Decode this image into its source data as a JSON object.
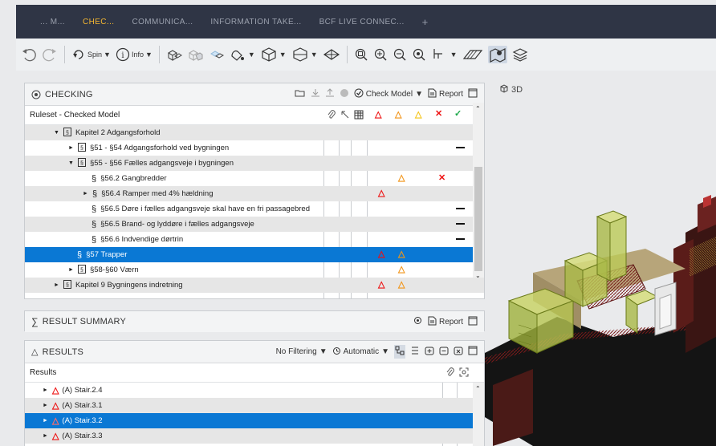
{
  "tabs": [
    {
      "label": "... M...",
      "active": false
    },
    {
      "label": "CHEC...",
      "active": true
    },
    {
      "label": "COMMUNICA...",
      "active": false
    },
    {
      "label": "INFORMATION TAKE...",
      "active": false
    },
    {
      "label": "BCF LIVE CONNEC...",
      "active": false
    },
    {
      "label": "+",
      "active": false
    }
  ],
  "toolbar": {
    "spin_label": "Spin",
    "info_label": "Info"
  },
  "checking": {
    "title": "CHECKING",
    "check_model_label": "Check Model",
    "report_label": "Report",
    "column_header": "Ruleset - Checked Model",
    "rows": [
      {
        "label": "Kapitel 2 Adgangsforhold",
        "indent": 1,
        "arrow": "▼",
        "icon": "book",
        "marks": []
      },
      {
        "label": "§51 - §54 Adgangsforhold ved bygningen",
        "indent": 2,
        "arrow": "►",
        "icon": "book",
        "marks": [
          "dash"
        ]
      },
      {
        "label": "§55 - §56  Fælles adgangsveje i bygningen",
        "indent": 2,
        "arrow": "▼",
        "icon": "book",
        "marks": []
      },
      {
        "label": "§56.2 Gangbredder",
        "indent": 3,
        "arrow": "",
        "icon": "para",
        "marks": [
          "orange",
          "x"
        ]
      },
      {
        "label": "§56.4 Ramper med 4% hældning",
        "indent": 3,
        "arrow": "►",
        "icon": "para",
        "marks": [
          "red"
        ]
      },
      {
        "label": "§56.5 Døre i fælles adgangsveje skal have en fri passagebred",
        "indent": 3,
        "arrow": "",
        "icon": "para",
        "marks": [
          "dash"
        ]
      },
      {
        "label": "§56.5 Brand- og lyddøre i fælles adgangsveje",
        "indent": 3,
        "arrow": "",
        "icon": "para",
        "marks": [
          "dash"
        ]
      },
      {
        "label": "§56.6 Indvendige dørtrin",
        "indent": 3,
        "arrow": "",
        "icon": "para",
        "marks": [
          "dash"
        ]
      },
      {
        "label": "§57 Trapper",
        "indent": 2,
        "arrow": "",
        "icon": "para",
        "marks": [
          "red",
          "orange"
        ],
        "selected": true
      },
      {
        "label": "§58-§60 Værn",
        "indent": 2,
        "arrow": "►",
        "icon": "book",
        "marks": [
          "orange"
        ]
      },
      {
        "label": "Kapitel 9 Bygningens indretning",
        "indent": 1,
        "arrow": "►",
        "icon": "book",
        "marks": [
          "red",
          "orange"
        ]
      }
    ]
  },
  "result_summary": {
    "title": "RESULT SUMMARY",
    "report_label": "Report"
  },
  "results": {
    "title": "RESULTS",
    "filter_label": "No Filtering",
    "auto_label": "Automatic",
    "column_header": "Results",
    "rows": [
      {
        "label": "(A) Stair.2.4",
        "selected": false
      },
      {
        "label": "(A) Stair.3.1",
        "selected": false
      },
      {
        "label": "(A) Stair.3.2",
        "selected": true
      },
      {
        "label": "(A) Stair.3.3",
        "selected": false
      }
    ]
  },
  "view": {
    "label": "3D"
  },
  "colors": {
    "accent": "#f5b731",
    "selection": "#0a78d4",
    "tabbar": "#2f3545",
    "critical": "#e11111",
    "moderate": "#f29417",
    "low": "#f5c518",
    "pass": "#1ca84a"
  }
}
